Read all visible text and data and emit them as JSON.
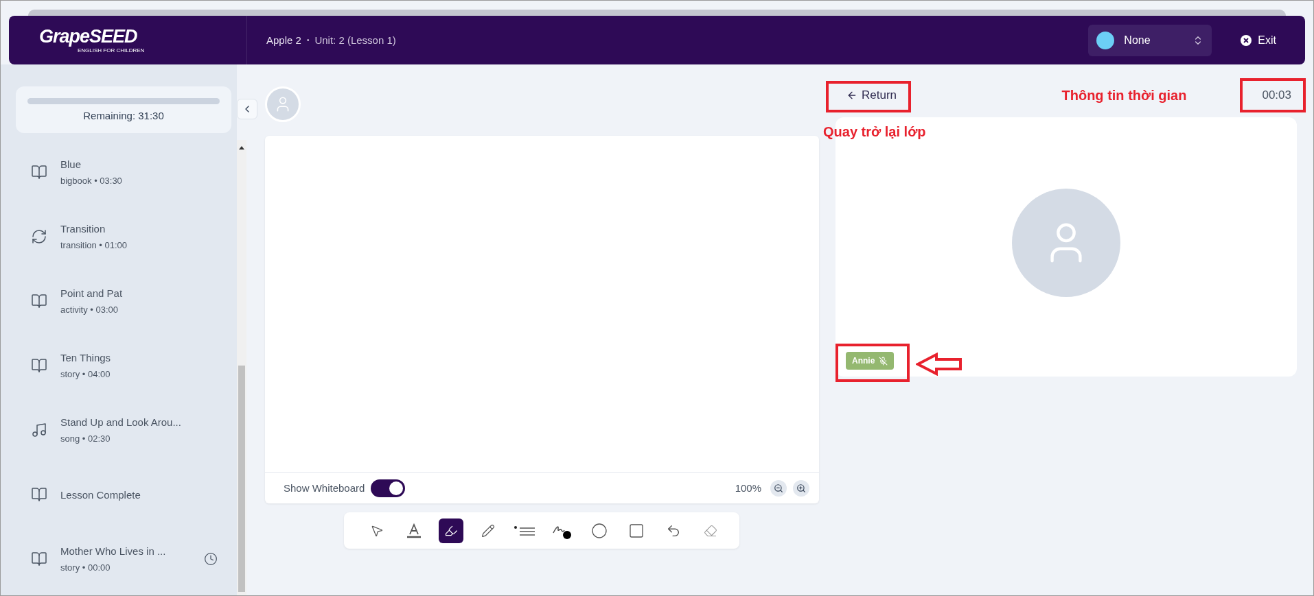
{
  "header": {
    "logo": {
      "name": "GrapeSEED",
      "tagline": "ENGLISH FOR CHILDREN"
    },
    "course": "Apple 2",
    "separator": "•",
    "unit": "Unit: 2 (Lesson 1)",
    "select": {
      "value": "None",
      "color": "#6ccff6"
    },
    "exit": "Exit"
  },
  "sidebar": {
    "remaining": {
      "label": "Remaining: 31:30",
      "level": 0
    },
    "items": [
      {
        "kind": "book",
        "title": "Blue",
        "meta": "bigbook • 03:30",
        "timer": false
      },
      {
        "kind": "transition",
        "title": "Transition",
        "meta": "transition • 01:00",
        "timer": false
      },
      {
        "kind": "book",
        "title": "Point and Pat",
        "meta": "activity • 03:00",
        "timer": false
      },
      {
        "kind": "book",
        "title": "Ten Things",
        "meta": "story • 04:00",
        "timer": false
      },
      {
        "kind": "song",
        "title": "Stand Up and Look Arou...",
        "meta": "song • 02:30",
        "timer": false
      },
      {
        "kind": "book",
        "title": "Lesson Complete",
        "timer": false
      },
      {
        "kind": "book",
        "title": "Mother Who Lives in ...",
        "meta": "story • 00:00",
        "timer": true
      }
    ]
  },
  "whiteboard": {
    "show_whiteboard": {
      "label": "Show Whiteboard",
      "on": true
    },
    "zoom": "100%",
    "tools": [
      {
        "kind": "pointer",
        "selected": false
      },
      {
        "kind": "text",
        "selected": false
      },
      {
        "kind": "highlighter",
        "selected": true
      },
      {
        "kind": "pencil",
        "selected": false
      },
      {
        "kind": "line-width",
        "selected": false
      },
      {
        "kind": "pen-color",
        "selected": false
      },
      {
        "kind": "circle",
        "selected": false
      },
      {
        "kind": "rectangle",
        "selected": false
      },
      {
        "kind": "undo",
        "selected": false
      },
      {
        "kind": "eraser",
        "selected": false
      }
    ]
  },
  "stage": {
    "return": "Return",
    "timer": "00:03",
    "participant": {
      "name": "Annie",
      "muted": true
    }
  },
  "annotations": {
    "time_label": "Thông tin thời gian",
    "return_label": "Quay trở lại lớp"
  }
}
